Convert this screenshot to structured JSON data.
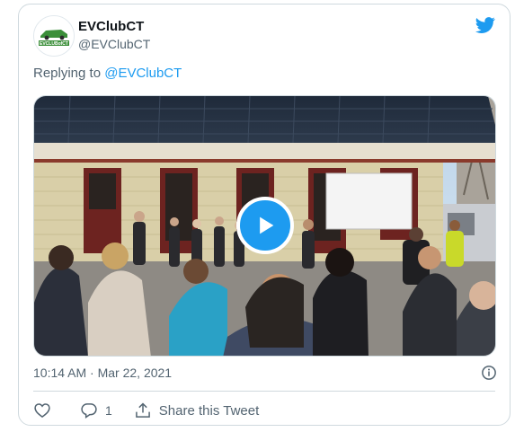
{
  "tweet": {
    "display_name": "EVClubCT",
    "handle": "@EVClubCT",
    "reply_prefix": "Replying to ",
    "reply_mention": "@EVClubCT",
    "timestamp": "10:14 AM · Mar 22, 2021",
    "comment_count": "1",
    "share_label": "Share this Tweet",
    "avatar_text": "EVCLUBofCT"
  },
  "colors": {
    "accent": "#1d9bf0",
    "text": "#0f1419",
    "muted": "#536471",
    "border": "#cfd9de",
    "avatar_green": "#3c8f3a"
  },
  "icons": {
    "brand": "twitter-bird-icon",
    "play": "play-icon",
    "info": "info-icon",
    "like": "heart-icon",
    "comment": "comment-icon",
    "share": "share-icon"
  }
}
